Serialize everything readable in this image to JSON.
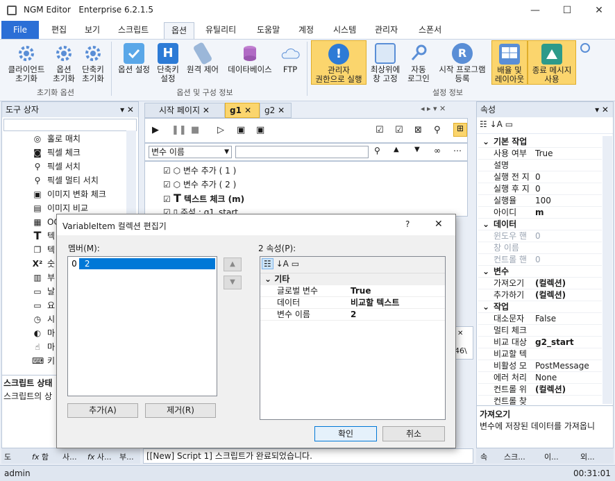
{
  "app": {
    "name": "NGM Editor",
    "edition": "Enterprise 6.2.1.5"
  },
  "window_controls": {
    "min": "—",
    "max": "☐",
    "close": "✕"
  },
  "menu": [
    "File",
    "편집",
    "보기",
    "스크립트",
    "옵션",
    "유틸리티",
    "도움말",
    "계정",
    "시스템",
    "관리자",
    "스폰서"
  ],
  "ribbon": {
    "buttons": [
      {
        "label": "클라이언트\n초기화",
        "icon": "client-reset-gear-icon"
      },
      {
        "label": "옵션\n초기화",
        "icon": "option-reset-gear-icon"
      },
      {
        "label": "단축키\n초기화",
        "icon": "hotkey-reset-gear-icon"
      },
      {
        "label": "옵션 설정",
        "icon": "checkbox-icon"
      },
      {
        "label": "단축키\n설정",
        "icon": "hotkey-h-icon"
      },
      {
        "label": "원격 제어",
        "icon": "remote-control-icon"
      },
      {
        "label": "데이타베이스",
        "icon": "database-icon"
      },
      {
        "label": "FTP",
        "icon": "ftp-cloud-icon"
      },
      {
        "label": "관리자\n권한으로 실행",
        "icon": "warning-shield-icon"
      },
      {
        "label": "최상위에\n창 고정",
        "icon": "window-pin-icon"
      },
      {
        "label": "자동\n로그인",
        "icon": "key-icon"
      },
      {
        "label": "시작 프로그램\n등록",
        "icon": "r-circle-icon"
      },
      {
        "label": "배율 및\n레이아웃",
        "icon": "monitor-layout-icon"
      },
      {
        "label": "종료 메시지\n사용",
        "icon": "exit-message-icon"
      }
    ],
    "groups": [
      "초기화 옵션",
      "옵션 및 구성 정보",
      "설정 정보"
    ]
  },
  "toolbox": {
    "title": "도구 상자",
    "items": [
      "홀로 매치",
      "픽셀 체크",
      "픽셀 서치",
      "픽셀 멀티 서치",
      "이미지 변화 체크",
      "이미지 비교",
      "OC",
      "텍",
      "텍",
      "숫",
      "부",
      "날",
      "요",
      "시",
      "마",
      "마",
      "키"
    ],
    "status_title": "스크립트 상태",
    "status_text": "스크립트의 상"
  },
  "editor": {
    "tabs": [
      "시작 페이지",
      "g1",
      "g2"
    ],
    "dropdown": "변수 이름",
    "search_value": "",
    "lines": [
      "변수 추가 ( 1 )",
      "변수 추가 ( 2 )",
      "텍스트 체크 (m)",
      "주석 : g1_start"
    ],
    "partial_cell": "46\\"
  },
  "bottom_tabs": [
    "도",
    "함",
    "사...",
    "사...",
    "부..."
  ],
  "output_line": "[[New] Script 1] 스크립트가 완료되었습니다.",
  "properties": {
    "title": "속성",
    "rows": [
      {
        "cat": "기본 작업"
      },
      {
        "k": "사용 여부",
        "v": "True"
      },
      {
        "k": "설명",
        "v": ""
      },
      {
        "k": "실행 전 지",
        "v": "0"
      },
      {
        "k": "실행 후 지",
        "v": "0"
      },
      {
        "k": "실행율",
        "v": "100"
      },
      {
        "k": "아이디",
        "v": "m",
        "b": true
      },
      {
        "cat": "데이터"
      },
      {
        "k": "윈도우 핸",
        "v": "0",
        "g": true
      },
      {
        "k": "창 이름",
        "v": "",
        "g": true
      },
      {
        "k": "컨트롤 핸",
        "v": "0",
        "g": true
      },
      {
        "cat": "변수"
      },
      {
        "k": "가져오기",
        "v": "(컬렉션)",
        "b": true
      },
      {
        "k": "추가하기",
        "v": "(컬렉션)",
        "b": true
      },
      {
        "cat": "작업"
      },
      {
        "k": "대소문자",
        "v": "False"
      },
      {
        "k": "멀티 체크",
        "v": ""
      },
      {
        "k": "비교 대상",
        "v": "g2_start",
        "b": true
      },
      {
        "k": "비교할 텍",
        "v": ""
      },
      {
        "k": "비활성 모",
        "v": "PostMessage"
      },
      {
        "k": "에러 처리",
        "v": "None"
      },
      {
        "k": "컨트롤 위",
        "v": "(컬렉션)",
        "b": true
      },
      {
        "k": "컨트롤 찾",
        "v": ""
      }
    ],
    "desc_title": "가져오기",
    "desc_text": "변수에 저장된 데이터를 가져옵니",
    "bottom_tabs": [
      "속",
      "스크...",
      "이...",
      "외..."
    ]
  },
  "status": {
    "user": "admin",
    "time": "00:31:01"
  },
  "dialog": {
    "title": "VariableItem 컬렉션 편집기",
    "help": "?",
    "members_label": "멤버(M):",
    "members": [
      {
        "index": "0",
        "value": "2"
      }
    ],
    "props_label": "2 속성(P):",
    "category": "기타",
    "props": [
      {
        "k": "글로벌 변수",
        "v": "True"
      },
      {
        "k": "데이터",
        "v": "비교할 텍스트"
      },
      {
        "k": "변수 이름",
        "v": "2"
      }
    ],
    "add": "추가(A)",
    "remove": "제거(R)",
    "ok": "확인",
    "cancel": "취소"
  }
}
